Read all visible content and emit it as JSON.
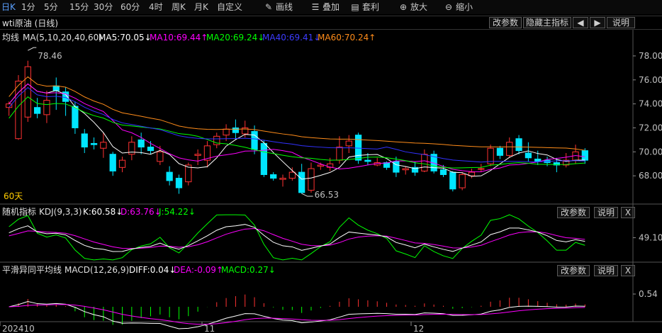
{
  "toolbar": {
    "timeframes": [
      "日K",
      "1分",
      "5分",
      "15分",
      "30分",
      "60分",
      "4时",
      "周K",
      "月K",
      "自定义"
    ],
    "active": "日K",
    "tools": [
      {
        "label": "画线",
        "icon": "pencil-icon",
        "glyph": "✎"
      },
      {
        "label": "叠加",
        "icon": "layers-icon",
        "glyph": "☰"
      },
      {
        "label": "套利",
        "icon": "document-icon",
        "glyph": "▤"
      },
      {
        "label": "放大",
        "icon": "zoom-in-icon",
        "glyph": "⊕"
      },
      {
        "label": "缩小",
        "icon": "zoom-out-icon",
        "glyph": "⊖"
      }
    ]
  },
  "title": "wti原油 (日线)",
  "title_buttons": {
    "modify_params": "改参数",
    "hide_indicator": "隐藏主指标",
    "prev": "◀",
    "next": "▶",
    "help": "说明"
  },
  "main_panel": {
    "indicator": "均线",
    "params": "MA(5,10,20,40,60)",
    "ma5": "MA5:70.05↓",
    "ma10": "MA10:69.44↑",
    "ma20": "MA20:69.24↓",
    "ma40": "MA40:69.41↓",
    "ma60": "MA60:70.24↑",
    "high_label": "78.46",
    "low_label": "66.53",
    "period_note": "60天",
    "y_ticks": [
      "78.00",
      "76.00",
      "74.00",
      "72.00",
      "70.00",
      "68.00"
    ]
  },
  "kdj_panel": {
    "name": "随机指标",
    "params": "KDJ(9,3,3)",
    "k": "K:60.58↓",
    "d": "D:63.76↓",
    "j": "J:54.22↓",
    "modify_params": "改参数",
    "help": "说明",
    "close": "X",
    "y_tick": "49.10"
  },
  "macd_panel": {
    "name": "平滑异同平均线",
    "params": "MACD(12,26,9)",
    "diff": "DIFF:0.04↓",
    "dea": "DEA:-0.09↑",
    "macd": "MACD:0.27↓",
    "modify_params": "改参数",
    "help": "说明",
    "close": "X",
    "y_tick": "0.54"
  },
  "x_axis": {
    "labels": [
      "202410",
      "11",
      "12"
    ]
  },
  "colors": {
    "up": "#ff3232",
    "down": "#00e5ff",
    "ma5": "#ffffff",
    "ma10": "#ff00ff",
    "ma20": "#00ff00",
    "ma40": "#3232ff",
    "ma60": "#ff8c1a",
    "k": "#ffffff",
    "d": "#ff00ff",
    "j": "#00ff00",
    "diff": "#ffffff",
    "dea": "#ff00ff"
  },
  "chart_data": {
    "type": "candlestick",
    "ylim": [
      66,
      79
    ],
    "candles": [
      [
        73.7,
        74.0,
        73.0,
        74.2
      ],
      [
        71.1,
        75.9,
        71.0,
        76.4
      ],
      [
        72.9,
        77.1,
        72.5,
        77.6
      ],
      [
        73.7,
        73.2,
        72.8,
        74.5
      ],
      [
        73.1,
        74.3,
        72.4,
        75.1
      ],
      [
        75.5,
        75.1,
        73.5,
        76.2
      ],
      [
        75.0,
        74.2,
        73.0,
        75.4
      ],
      [
        73.8,
        72.0,
        71.5,
        74.2
      ],
      [
        71.5,
        70.4,
        69.9,
        71.9
      ],
      [
        70.7,
        70.6,
        70.2,
        71.2
      ],
      [
        70.3,
        70.8,
        69.5,
        71.6
      ],
      [
        69.8,
        68.4,
        68.0,
        70.0
      ],
      [
        68.7,
        69.3,
        68.3,
        69.6
      ],
      [
        69.8,
        70.8,
        69.3,
        71.3
      ],
      [
        71.0,
        70.4,
        69.8,
        71.6
      ],
      [
        70.4,
        70.1,
        69.8,
        70.9
      ],
      [
        69.2,
        70.0,
        68.9,
        70.5
      ],
      [
        68.3,
        67.6,
        67.2,
        68.8
      ],
      [
        67.8,
        67.0,
        66.5,
        68.1
      ],
      [
        67.5,
        68.9,
        67.2,
        69.1
      ],
      [
        69.7,
        69.8,
        68.9,
        70.2
      ],
      [
        69.3,
        70.5,
        68.7,
        70.9
      ],
      [
        70.6,
        71.3,
        70.3,
        71.6
      ],
      [
        71.4,
        71.9,
        70.9,
        72.3
      ],
      [
        72.0,
        71.6,
        71.0,
        72.7
      ],
      [
        71.5,
        72.0,
        71.2,
        72.6
      ],
      [
        71.7,
        70.2,
        69.8,
        72.2
      ],
      [
        70.7,
        68.1,
        67.9,
        71.0
      ],
      [
        68.1,
        67.8,
        67.6,
        68.3
      ],
      [
        67.7,
        67.8,
        67.1,
        68.1
      ],
      [
        67.8,
        68.3,
        67.6,
        68.7
      ],
      [
        68.3,
        66.6,
        66.5,
        69.0
      ],
      [
        66.8,
        68.6,
        66.6,
        69.1
      ],
      [
        68.8,
        68.9,
        68.5,
        69.1
      ],
      [
        68.7,
        69.0,
        68.4,
        69.5
      ],
      [
        69.3,
        70.4,
        69.0,
        71.3
      ],
      [
        70.5,
        70.9,
        69.9,
        71.4
      ],
      [
        71.4,
        69.3,
        69.0,
        71.6
      ],
      [
        69.3,
        69.2,
        68.9,
        69.9
      ],
      [
        68.9,
        69.1,
        68.8,
        69.5
      ],
      [
        69.1,
        68.7,
        68.5,
        69.2
      ],
      [
        69.2,
        68.3,
        67.9,
        69.6
      ],
      [
        68.5,
        68.6,
        68.1,
        68.8
      ],
      [
        68.7,
        68.3,
        68.0,
        69.2
      ],
      [
        68.4,
        69.8,
        68.3,
        70.2
      ],
      [
        69.8,
        68.4,
        68.2,
        70.1
      ],
      [
        68.5,
        68.1,
        67.9,
        68.9
      ],
      [
        68.3,
        66.9,
        66.7,
        68.4
      ],
      [
        67.0,
        68.1,
        66.8,
        68.3
      ],
      [
        68.0,
        68.3,
        67.8,
        68.6
      ],
      [
        68.6,
        68.6,
        68.3,
        69.0
      ],
      [
        69.0,
        70.3,
        68.8,
        70.6
      ],
      [
        70.3,
        69.7,
        69.4,
        70.5
      ],
      [
        69.7,
        70.8,
        69.5,
        71.2
      ],
      [
        71.1,
        70.1,
        69.8,
        71.4
      ],
      [
        69.9,
        69.5,
        69.2,
        70.8
      ],
      [
        69.4,
        69.2,
        68.9,
        70.1
      ],
      [
        69.3,
        69.1,
        68.8,
        69.6
      ],
      [
        69.1,
        68.9,
        68.3,
        69.5
      ],
      [
        68.9,
        69.3,
        68.7,
        69.9
      ],
      [
        69.3,
        70.0,
        69.0,
        70.6
      ],
      [
        70.1,
        69.3,
        69.0,
        70.3
      ]
    ]
  }
}
